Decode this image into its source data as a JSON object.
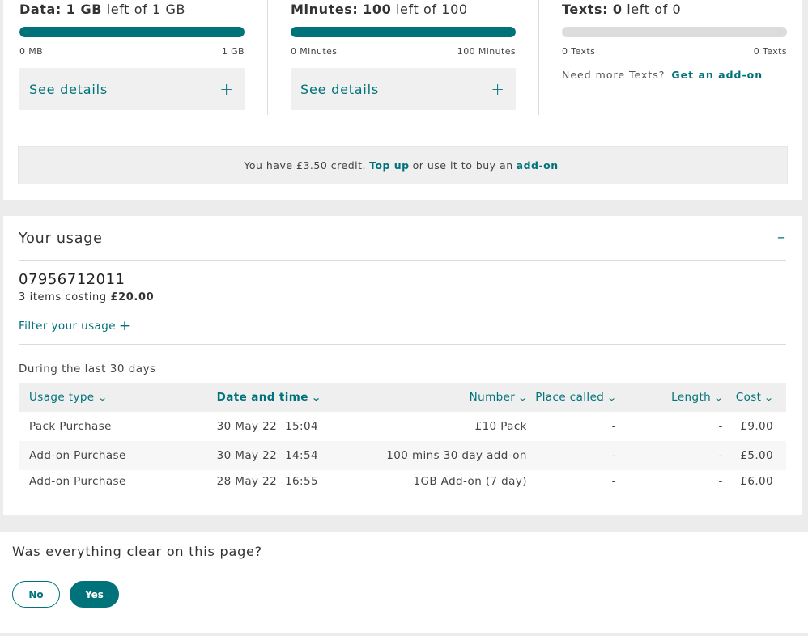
{
  "allowances": [
    {
      "name": "Data:",
      "amount": "1 GB",
      "suffix": "left of 1 GB",
      "fill": 1.0,
      "min_label": "0 MB",
      "max_label": "1 GB",
      "details_label": "See details",
      "color": "#00737a"
    },
    {
      "name": "Minutes:",
      "amount": "100",
      "suffix": "left of 100",
      "fill": 1.0,
      "min_label": "0 Minutes",
      "max_label": "100 Minutes",
      "details_label": "See details",
      "color": "#00737a"
    },
    {
      "name": "Texts:",
      "amount": "0",
      "suffix": "left of 0",
      "fill": 0.0,
      "min_label": "0 Texts",
      "max_label": "0 Texts",
      "color": "#dcdcdc"
    }
  ],
  "texts_addon": {
    "prompt": "Need more Texts?",
    "link": "Get an add-on"
  },
  "credit": {
    "before": "You have £3.50 credit.",
    "top_up": "Top up",
    "middle": "or use it to buy an",
    "add_on": "add-on"
  },
  "usage": {
    "title": "Your usage",
    "collapse_icon": "minus-icon",
    "phone_number": "07956712011",
    "items_prefix": "3 items costing",
    "items_total": "£20.00",
    "filter_label": "Filter your usage",
    "period": "During the last 30 days",
    "columns": [
      "Usage type",
      "Date and time",
      "Number",
      "Place called",
      "Length",
      "Cost"
    ],
    "rows": [
      {
        "type": "Pack Purchase",
        "date": "30 May 22",
        "time": "15:04",
        "number": "£10 Pack",
        "place": "-",
        "length": "-",
        "cost": "£9.00"
      },
      {
        "type": "Add-on Purchase",
        "date": "30 May 22",
        "time": "14:54",
        "number": "100 mins 30 day add-on",
        "place": "-",
        "length": "-",
        "cost": "£5.00"
      },
      {
        "type": "Add-on Purchase",
        "date": "28 May 22",
        "time": "16:55",
        "number": "1GB Add-on (7 day)",
        "place": "-",
        "length": "-",
        "cost": "£6.00"
      }
    ]
  },
  "feedback": {
    "question": "Was everything clear on this page?",
    "no_label": "No",
    "yes_label": "Yes"
  },
  "colors": {
    "accent": "#00737a",
    "track": "#dcdcdc",
    "panel": "#efefef"
  }
}
